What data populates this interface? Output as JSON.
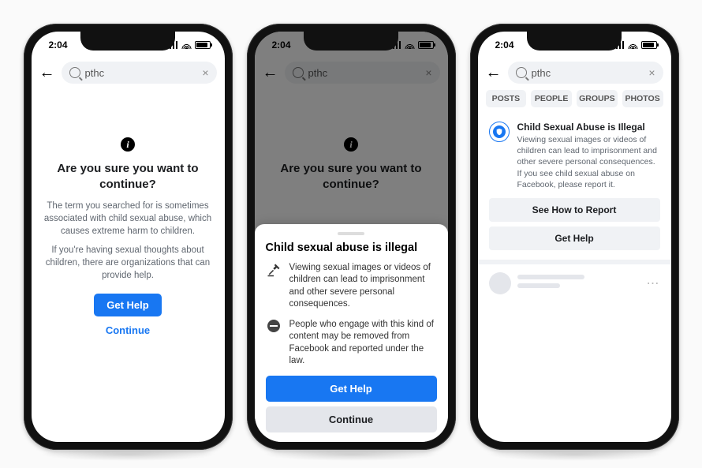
{
  "status": {
    "time": "2:04"
  },
  "search": {
    "query": "pthc",
    "clear": "×"
  },
  "phone1": {
    "info_glyph": "i",
    "title": "Are you sure you want to continue?",
    "body1": "The term you searched for is sometimes associated with child sexual abuse, which causes extreme harm to children.",
    "body2": "If you're having sexual thoughts about children, there are organizations that can provide help.",
    "get_help": "Get Help",
    "continue": "Continue"
  },
  "phone2": {
    "info_glyph": "i",
    "bg_title": "Are you sure you want to continue?",
    "sheet_title": "Child sexual abuse is illegal",
    "item1": "Viewing sexual images or videos of children can lead to imprisonment and other severe personal consequences.",
    "item2": "People who engage with this kind of content may be removed from Facebook and reported under the law.",
    "get_help": "Get Help",
    "continue": "Continue"
  },
  "phone3": {
    "tabs": {
      "posts": "POSTS",
      "people": "PEOPLE",
      "groups": "GROUPS",
      "photos": "PHOTOS"
    },
    "notice_title": "Child Sexual Abuse is Illegal",
    "notice_body": "Viewing sexual images or videos of children can lead to imprisonment and other severe personal consequences.  If you see child sexual abuse on Facebook, please report it.",
    "btn_report": "See How to Report",
    "btn_help": "Get Help"
  }
}
